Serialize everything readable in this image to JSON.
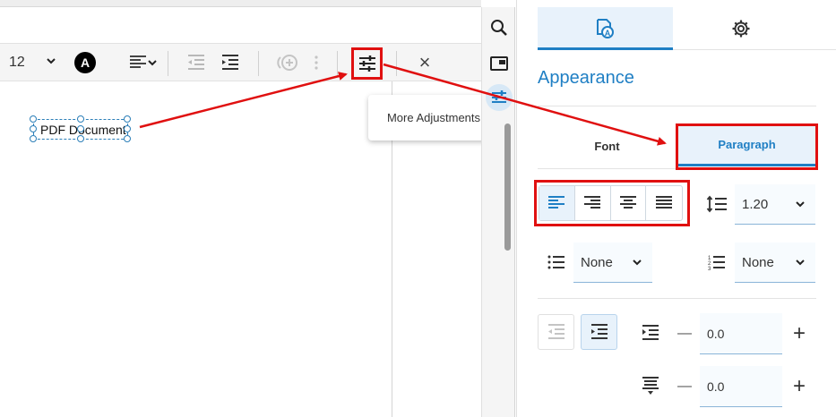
{
  "toolbar": {
    "font_size": "12",
    "color_letter": "A",
    "close_symbol": "×"
  },
  "document": {
    "text_box": "PDF Document"
  },
  "tooltip": {
    "text": "More Adjustments"
  },
  "panel": {
    "title": "Appearance",
    "tabs": {
      "font": "Font",
      "paragraph": "Paragraph"
    },
    "line_spacing": "1.20",
    "bullet_list": "None",
    "numbered_list": "None",
    "indent_value": "0.0",
    "spacing_value": "0.0",
    "minus": "—",
    "plus": "+"
  },
  "colors": {
    "accent": "#1f7fc4",
    "annotation": "#e01010"
  },
  "icons": [
    "search-icon",
    "picture-in-picture-icon",
    "sliders-icon",
    "appearance-icon",
    "gear-icon",
    "chevron-down-icon",
    "align-left-icon",
    "align-right-icon",
    "align-center-icon",
    "justify-icon",
    "line-spacing-icon",
    "bulleted-list-icon",
    "numbered-list-icon",
    "outdent-icon",
    "indent-icon",
    "paragraph-spacing-icon",
    "more-vertical-icon",
    "close-icon"
  ]
}
